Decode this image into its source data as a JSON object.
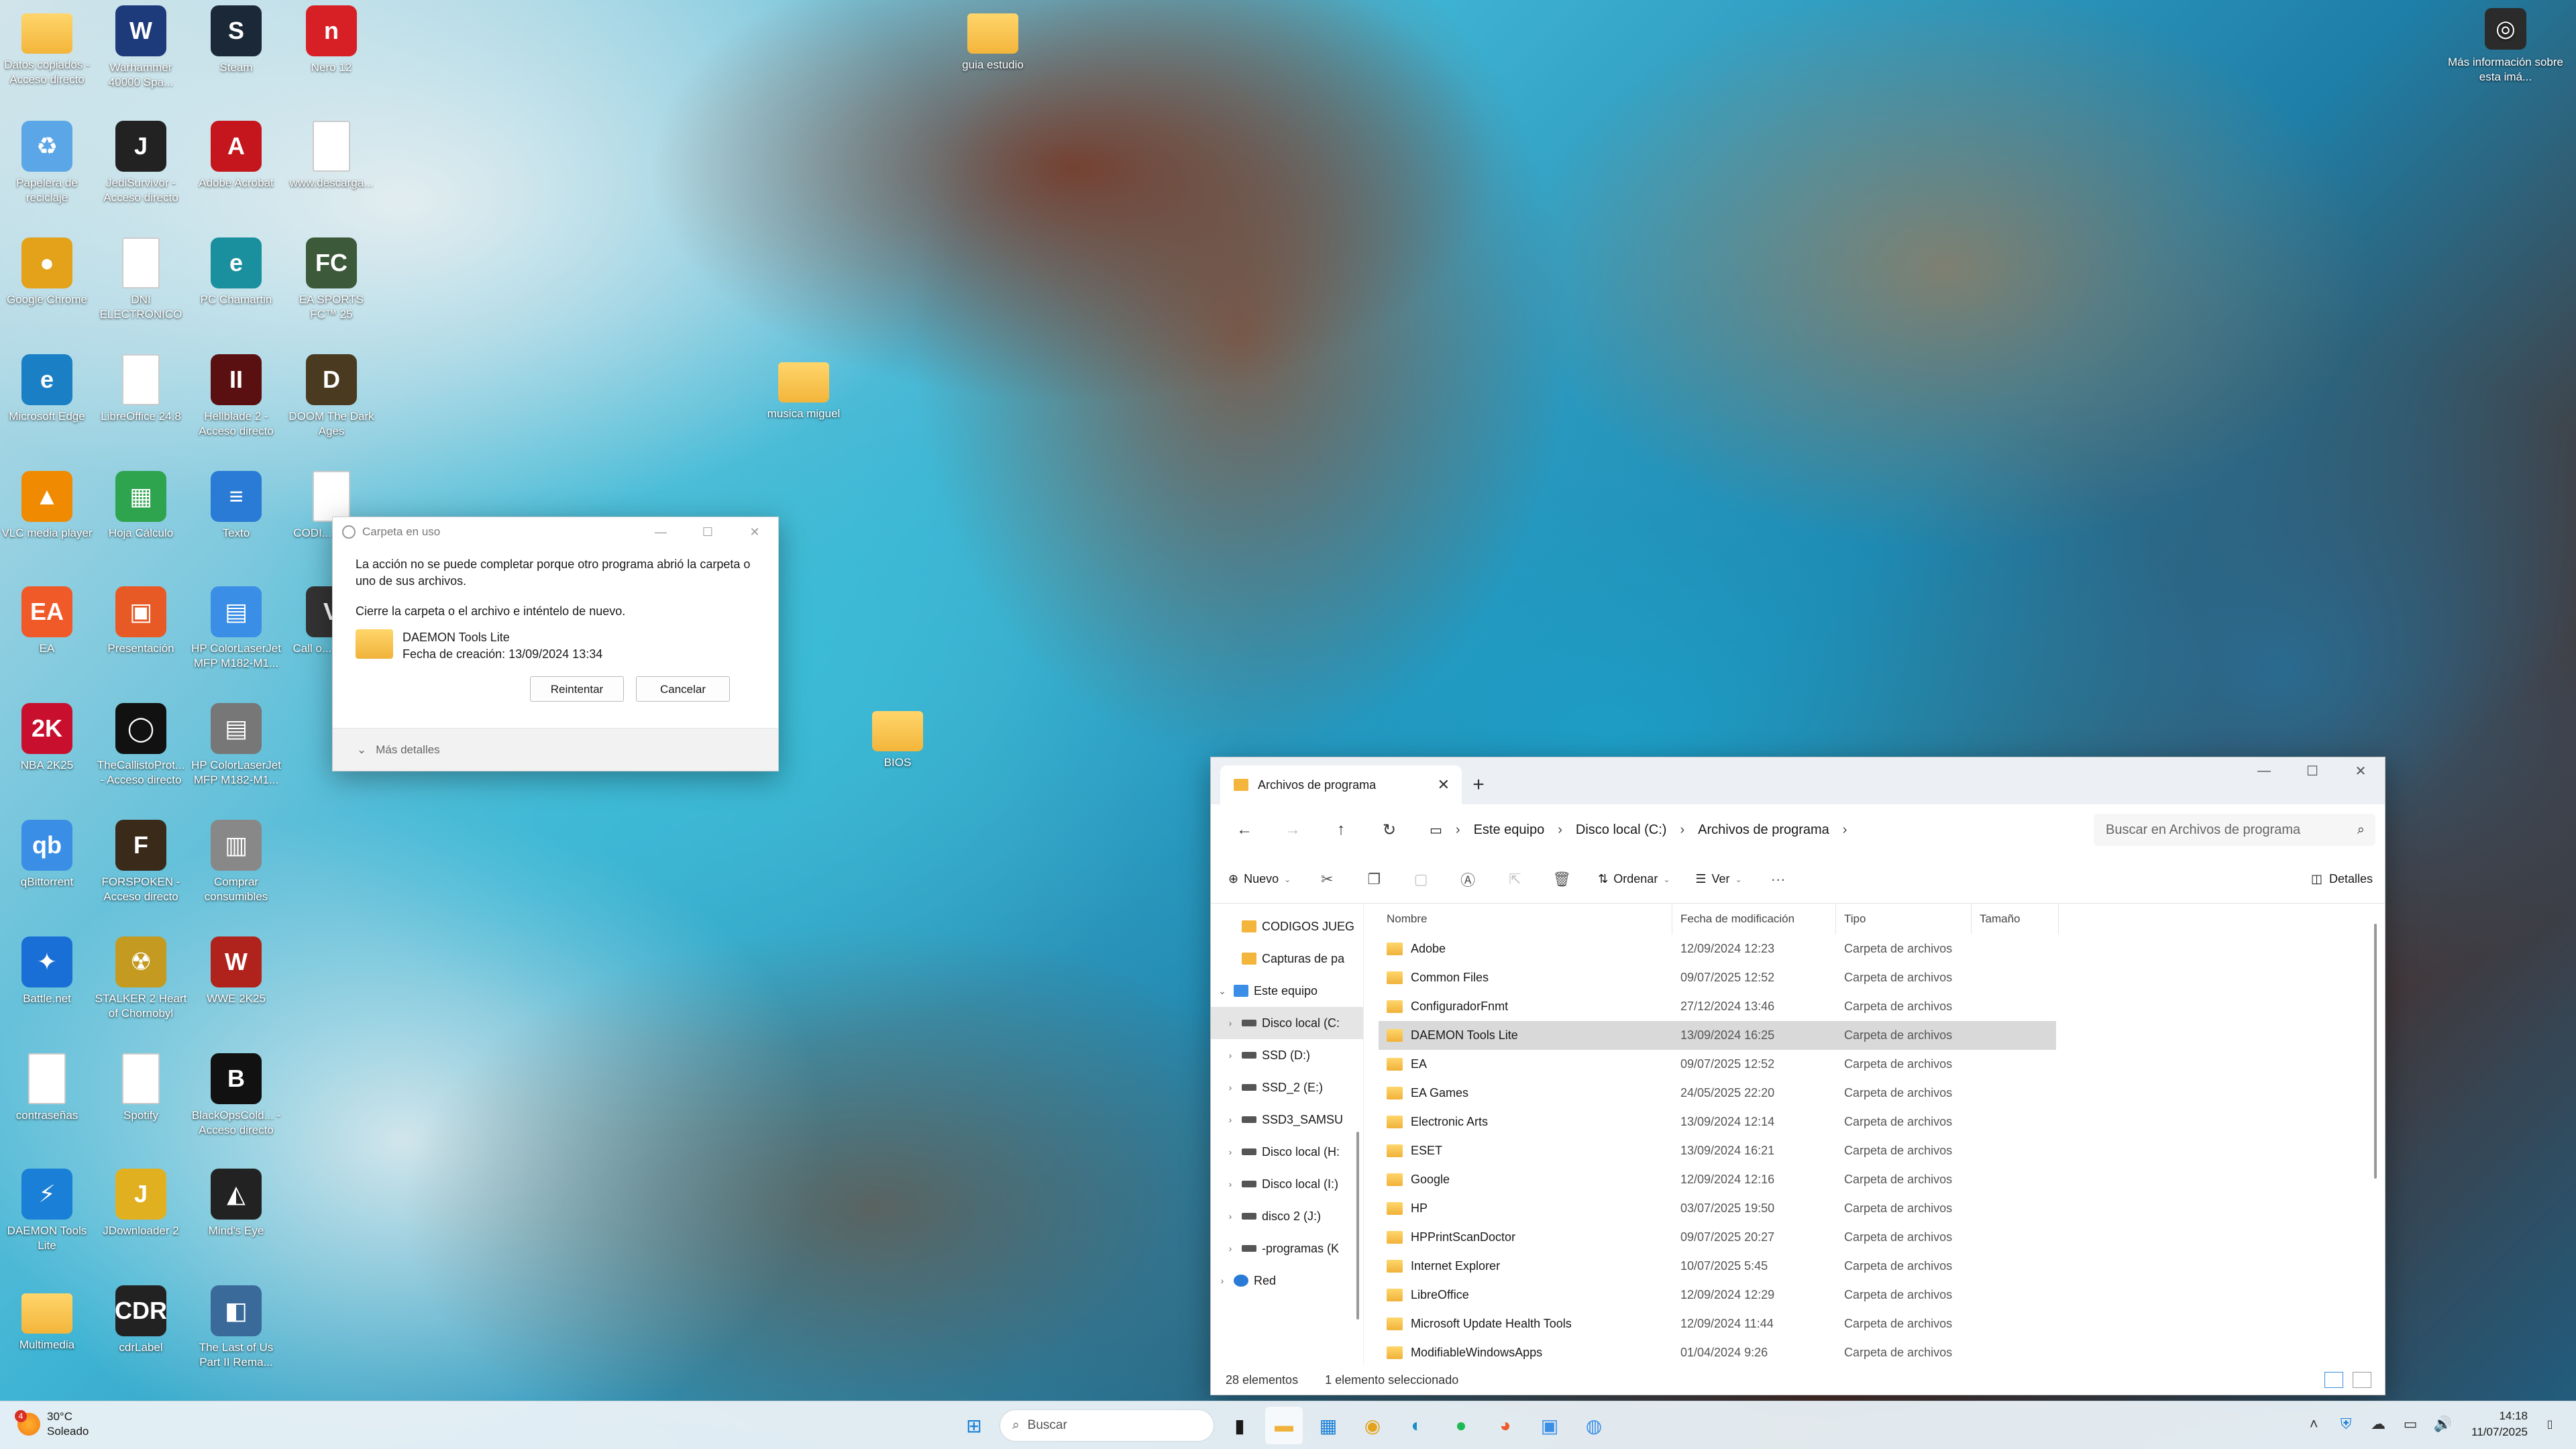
{
  "desktop": {
    "icons": [
      {
        "label": "Datos copiados - Acceso directo",
        "glyph": "folder",
        "sym": ""
      },
      {
        "label": "Warhammer 40000 Spa...",
        "glyph": "app",
        "sym": "W",
        "color": "#1d3a7a"
      },
      {
        "label": "Steam",
        "glyph": "app",
        "sym": "S",
        "color": "#1b2838"
      },
      {
        "label": "Nero 12",
        "glyph": "app",
        "sym": "n",
        "color": "#d71f26"
      },
      {
        "label": "Papelera de reciclaje",
        "glyph": "app",
        "sym": "♻",
        "color": "#5aa6e6"
      },
      {
        "label": "JediSurvivor - Acceso directo",
        "glyph": "app",
        "sym": "J",
        "color": "#222222"
      },
      {
        "label": "Adobe Acrobat",
        "glyph": "app",
        "sym": "A",
        "color": "#c4161c"
      },
      {
        "label": "www.descarga...",
        "glyph": "doc",
        "sym": ""
      },
      {
        "label": "Google Chrome",
        "glyph": "app",
        "sym": "●",
        "color": "#e3a21a"
      },
      {
        "label": "DNI ELECTRONICO",
        "glyph": "doc",
        "sym": ""
      },
      {
        "label": "PC Chamartin",
        "glyph": "app",
        "sym": "e",
        "color": "#1a8f9e"
      },
      {
        "label": "EA SPORTS FC™ 25",
        "glyph": "app",
        "sym": "FC",
        "color": "#3c5a3a"
      },
      {
        "label": "Microsoft Edge",
        "glyph": "app",
        "sym": "e",
        "color": "#1a7fc4"
      },
      {
        "label": "LibreOffice 24.8",
        "glyph": "doc",
        "sym": ""
      },
      {
        "label": "Hellblade 2 - Acceso directo",
        "glyph": "app",
        "sym": "II",
        "color": "#5a1010"
      },
      {
        "label": "DOOM The Dark Ages",
        "glyph": "app",
        "sym": "D",
        "color": "#4a3a20"
      },
      {
        "label": "VLC media player",
        "glyph": "app",
        "sym": "▲",
        "color": "#f08a00"
      },
      {
        "label": "Hoja Cálculo",
        "glyph": "app",
        "sym": "▦",
        "color": "#2fa44f"
      },
      {
        "label": "Texto",
        "glyph": "app",
        "sym": "≡",
        "color": "#2a7bd6"
      },
      {
        "label": "CODI... 5000...",
        "glyph": "doc",
        "sym": ""
      },
      {
        "label": "EA",
        "glyph": "app",
        "sym": "EA",
        "color": "#f05a28"
      },
      {
        "label": "Presentación",
        "glyph": "app",
        "sym": "▣",
        "color": "#e85a25"
      },
      {
        "label": "HP ColorLaserJet MFP M182-M1...",
        "glyph": "app",
        "sym": "▤",
        "color": "#3a8ee6"
      },
      {
        "label": "Call o... Vang...",
        "glyph": "app",
        "sym": "V",
        "color": "#333333"
      },
      {
        "label": "NBA 2K25",
        "glyph": "app",
        "sym": "2K",
        "color": "#c8102e"
      },
      {
        "label": "TheCallistoProt... - Acceso directo",
        "glyph": "app",
        "sym": "◯",
        "color": "#111111"
      },
      {
        "label": "HP ColorLaserJet MFP M182-M1...",
        "glyph": "app",
        "sym": "▤",
        "color": "#777777"
      },
      {
        "label": "qBittorrent",
        "glyph": "app",
        "sym": "qb",
        "color": "#3a8ee6"
      },
      {
        "label": "FORSPOKEN - Acceso directo",
        "glyph": "app",
        "sym": "F",
        "color": "#3a2a1a"
      },
      {
        "label": "Comprar consumibles",
        "glyph": "app",
        "sym": "▥",
        "color": "#888888"
      },
      {
        "label": "Battle.net",
        "glyph": "app",
        "sym": "✦",
        "color": "#1a6fd6"
      },
      {
        "label": "STALKER 2 Heart of Chornobyl",
        "glyph": "app",
        "sym": "☢",
        "color": "#c49a20"
      },
      {
        "label": "WWE 2K25",
        "glyph": "app",
        "sym": "W",
        "color": "#b0231c"
      },
      {
        "label": "contraseñas",
        "glyph": "doc",
        "sym": ""
      },
      {
        "label": "Spotify",
        "glyph": "doc",
        "sym": ""
      },
      {
        "label": "BlackOpsCold... - Acceso directo",
        "glyph": "app",
        "sym": "B",
        "color": "#111111"
      },
      {
        "label": "DAEMON Tools Lite",
        "glyph": "app",
        "sym": "⚡",
        "color": "#1a7fd6"
      },
      {
        "label": "JDownloader 2",
        "glyph": "app",
        "sym": "J",
        "color": "#e0b020"
      },
      {
        "label": "Mind's Eye",
        "glyph": "app",
        "sym": "◭",
        "color": "#222222"
      },
      {
        "label": "Multimedia",
        "glyph": "folder",
        "sym": ""
      },
      {
        "label": "cdrLabel",
        "glyph": "app",
        "sym": "CDR",
        "color": "#222222"
      },
      {
        "label": "The Last of Us Part II Rema...",
        "glyph": "app",
        "sym": "◧",
        "color": "#3a6a9a"
      },
      {
        "label": "guia estudio",
        "glyph": "folder",
        "sym": ""
      },
      {
        "label": "musica miguel",
        "glyph": "folder",
        "sym": ""
      },
      {
        "label": "BIOS",
        "glyph": "folder",
        "sym": ""
      }
    ],
    "widget": {
      "label": "Más información sobre esta imá...",
      "sym": "◎"
    }
  },
  "dialog": {
    "title": "Carpeta en uso",
    "message": "La acción no se puede completar porque otro programa abrió la carpeta o uno de sus archivos.",
    "instruction": "Cierre la carpeta o el archivo e inténtelo de nuevo.",
    "file_name": "DAEMON Tools Lite",
    "file_created": "Fecha de creación: 13/09/2024 13:34",
    "retry_label": "Reintentar",
    "cancel_label": "Cancelar",
    "details_label": "Más detalles"
  },
  "explorer": {
    "tab_title": "Archivos de programa",
    "breadcrumb": [
      "Este equipo",
      "Disco local (C:)",
      "Archivos de programa"
    ],
    "search_placeholder": "Buscar en Archivos de programa",
    "commands": {
      "new": "Nuevo",
      "sort": "Ordenar",
      "view": "Ver",
      "details": "Detalles"
    },
    "nav_items": [
      {
        "label": "CODIGOS JUEG",
        "icon": "folder",
        "indent": 1,
        "chevron": ""
      },
      {
        "label": "Capturas de pa",
        "icon": "folder",
        "indent": 1,
        "chevron": ""
      },
      {
        "label": "Este equipo",
        "icon": "pc",
        "indent": 0,
        "chevron": "v"
      },
      {
        "label": "Disco local (C:",
        "icon": "drive",
        "indent": 1,
        "chevron": ">",
        "selected": true
      },
      {
        "label": "SSD (D:)",
        "icon": "drive",
        "indent": 1,
        "chevron": ">"
      },
      {
        "label": "SSD_2 (E:)",
        "icon": "drive",
        "indent": 1,
        "chevron": ">"
      },
      {
        "label": "SSD3_SAMSU",
        "icon": "drive",
        "indent": 1,
        "chevron": ">"
      },
      {
        "label": "Disco local (H:",
        "icon": "drive",
        "indent": 1,
        "chevron": ">"
      },
      {
        "label": "Disco local (I:)",
        "icon": "drive",
        "indent": 1,
        "chevron": ">"
      },
      {
        "label": "disco 2 (J:)",
        "icon": "drive",
        "indent": 1,
        "chevron": ">"
      },
      {
        "label": "-programas (K",
        "icon": "drive",
        "indent": 1,
        "chevron": ">"
      },
      {
        "label": "Red",
        "icon": "net",
        "indent": 0,
        "chevron": ">"
      }
    ],
    "columns": [
      "Nombre",
      "Fecha de modificación",
      "Tipo",
      "Tamaño"
    ],
    "rows": [
      {
        "name": "Adobe",
        "date": "12/09/2024 12:23",
        "type": "Carpeta de archivos"
      },
      {
        "name": "Common Files",
        "date": "09/07/2025 12:52",
        "type": "Carpeta de archivos"
      },
      {
        "name": "ConfiguradorFnmt",
        "date": "27/12/2024 13:46",
        "type": "Carpeta de archivos"
      },
      {
        "name": "DAEMON Tools Lite",
        "date": "13/09/2024 16:25",
        "type": "Carpeta de archivos",
        "selected": true
      },
      {
        "name": "EA",
        "date": "09/07/2025 12:52",
        "type": "Carpeta de archivos"
      },
      {
        "name": "EA Games",
        "date": "24/05/2025 22:20",
        "type": "Carpeta de archivos"
      },
      {
        "name": "Electronic Arts",
        "date": "13/09/2024 12:14",
        "type": "Carpeta de archivos"
      },
      {
        "name": "ESET",
        "date": "13/09/2024 16:21",
        "type": "Carpeta de archivos"
      },
      {
        "name": "Google",
        "date": "12/09/2024 12:16",
        "type": "Carpeta de archivos"
      },
      {
        "name": "HP",
        "date": "03/07/2025 19:50",
        "type": "Carpeta de archivos"
      },
      {
        "name": "HPPrintScanDoctor",
        "date": "09/07/2025 20:27",
        "type": "Carpeta de archivos"
      },
      {
        "name": "Internet Explorer",
        "date": "10/07/2025 5:45",
        "type": "Carpeta de archivos"
      },
      {
        "name": "LibreOffice",
        "date": "12/09/2024 12:29",
        "type": "Carpeta de archivos"
      },
      {
        "name": "Microsoft Update Health Tools",
        "date": "12/09/2024 11:44",
        "type": "Carpeta de archivos"
      },
      {
        "name": "ModifiableWindowsApps",
        "date": "01/04/2024 9:26",
        "type": "Carpeta de archivos"
      }
    ],
    "status": {
      "count": "28 elementos",
      "selection": "1 elemento seleccionado"
    }
  },
  "taskbar": {
    "weather_temp": "30°C",
    "weather_desc": "Soleado",
    "weather_badge": "4",
    "search_placeholder": "Buscar",
    "time": "14:18",
    "date": "11/07/2025"
  }
}
